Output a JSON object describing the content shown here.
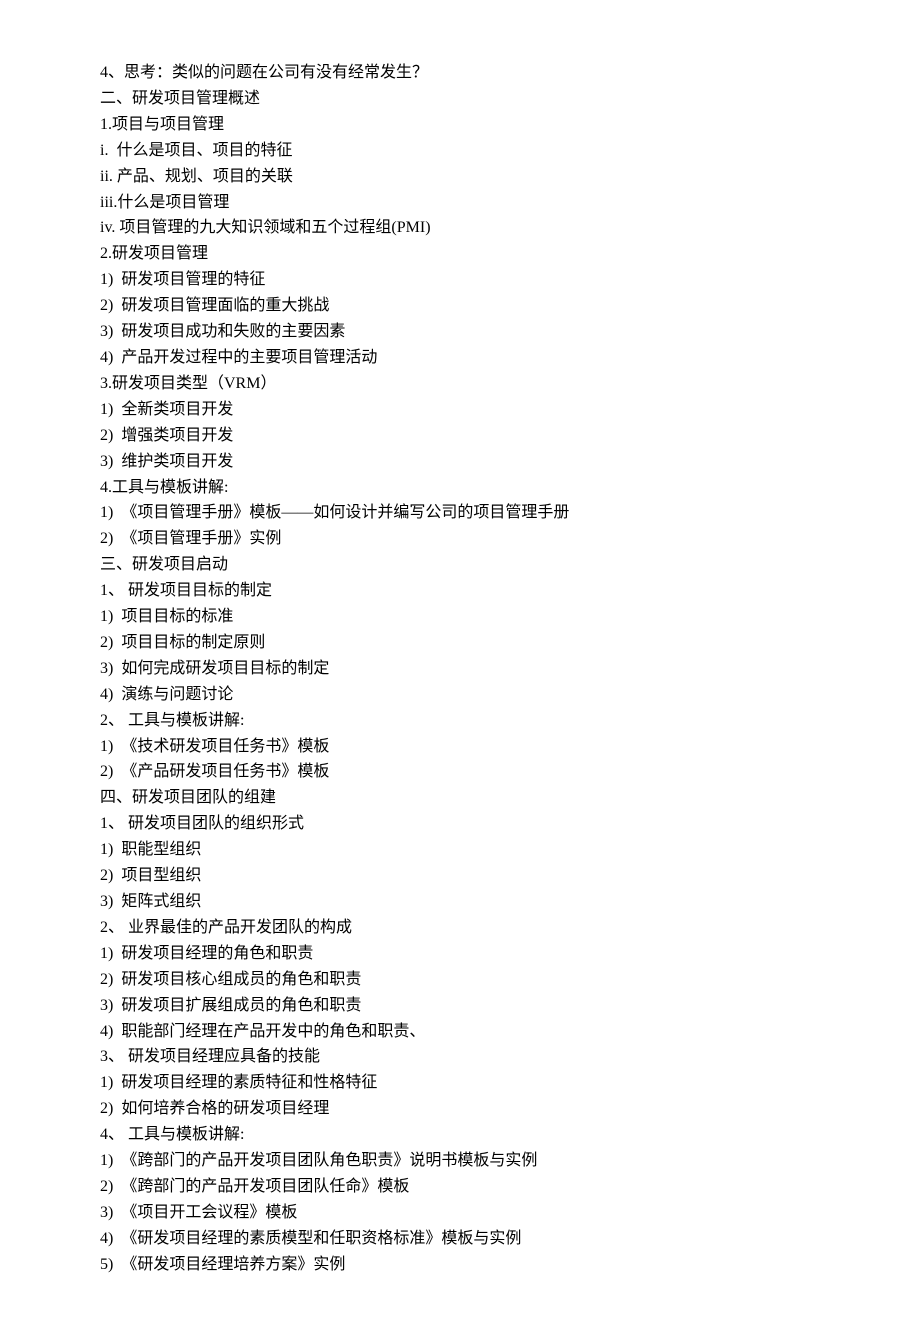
{
  "lines": [
    "4、思考：类似的问题在公司有没有经常发生？",
    "二、研发项目管理概述",
    "1.项目与项目管理",
    "i.  什么是项目、项目的特征",
    "ii. 产品、规划、项目的关联",
    "iii.什么是项目管理",
    "iv. 项目管理的九大知识领域和五个过程组(PMI)",
    "2.研发项目管理",
    "1)  研发项目管理的特征",
    "2)  研发项目管理面临的重大挑战",
    "3)  研发项目成功和失败的主要因素",
    "4)  产品开发过程中的主要项目管理活动",
    "3.研发项目类型（VRM）",
    "1)  全新类项目开发",
    "2)  增强类项目开发",
    "3)  维护类项目开发",
    "4.工具与模板讲解:",
    "1)  《项目管理手册》模板――如何设计并编写公司的项目管理手册",
    "2)  《项目管理手册》实例",
    "三、研发项目启动",
    "1、 研发项目目标的制定",
    "1)  项目目标的标准",
    "2)  项目目标的制定原则",
    "3)  如何完成研发项目目标的制定",
    "4)  演练与问题讨论",
    "2、 工具与模板讲解:",
    "1)  《技术研发项目任务书》模板",
    "2)  《产品研发项目任务书》模板",
    "四、研发项目团队的组建",
    "1、 研发项目团队的组织形式",
    "1)  职能型组织",
    "2)  项目型组织",
    "3)  矩阵式组织",
    "2、 业界最佳的产品开发团队的构成",
    "1)  研发项目经理的角色和职责",
    "2)  研发项目核心组成员的角色和职责",
    "3)  研发项目扩展组成员的角色和职责",
    "4)  职能部门经理在产品开发中的角色和职责、",
    "3、 研发项目经理应具备的技能",
    "1)  研发项目经理的素质特征和性格特征",
    "2)  如何培养合格的研发项目经理",
    "4、 工具与模板讲解:",
    "1)  《跨部门的产品开发项目团队角色职责》说明书模板与实例",
    "2)  《跨部门的产品开发项目团队任命》模板",
    "3)  《项目开工会议程》模板",
    "4)  《研发项目经理的素质模型和任职资格标准》模板与实例",
    "5)  《研发项目经理培养方案》实例"
  ]
}
